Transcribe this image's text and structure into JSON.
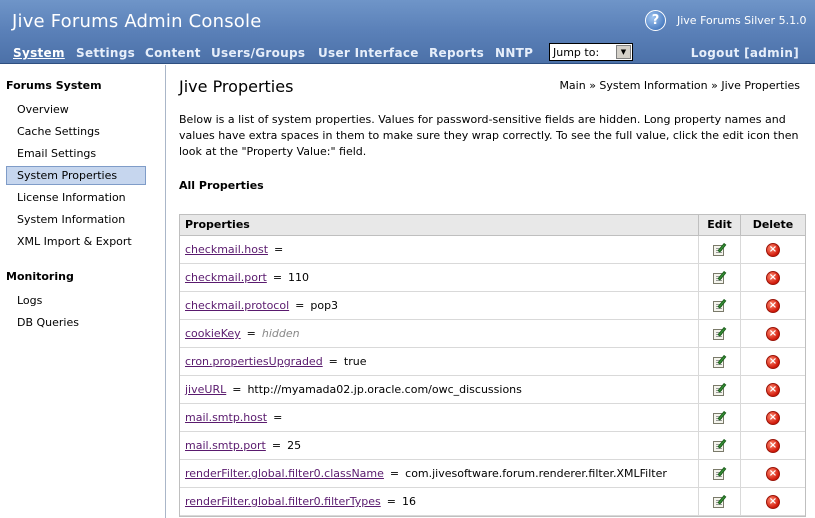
{
  "header": {
    "title": "Jive Forums Admin Console",
    "help_icon": "question-circle-icon",
    "edition": "Jive Forums Silver 5.1.0",
    "logout": "Logout [admin]",
    "jump_to": {
      "label": "Jump to:"
    }
  },
  "nav": [
    {
      "label": "System",
      "active": true
    },
    {
      "label": "Settings"
    },
    {
      "label": "Content"
    },
    {
      "label": "Users/Groups"
    },
    {
      "label": "User Interface"
    },
    {
      "label": "Reports"
    },
    {
      "label": "NNTP"
    }
  ],
  "sidebar": {
    "sections": [
      {
        "heading": "Forums System",
        "items": [
          "Overview",
          "Cache Settings",
          "Email Settings",
          "System Properties",
          "License Information",
          "System Information",
          "XML Import & Export"
        ]
      },
      {
        "heading": "Monitoring",
        "items": [
          "Logs",
          "DB Queries"
        ]
      }
    ],
    "active_item": "System Properties"
  },
  "main": {
    "title": "Jive Properties",
    "breadcrumb": "Main » System Information » Jive Properties",
    "description": "Below is a list of system properties. Values for password-sensitive fields are hidden. Long property names and values have extra spaces in them to make sure they wrap correctly. To see the full value, click the edit icon then look at the \"Property Value:\" field.",
    "section_title": "All Properties",
    "table": {
      "headers": {
        "properties": "Properties",
        "edit": "Edit",
        "delete": "Delete"
      },
      "edit_icon": "edit-document-icon",
      "delete_icon": "delete-circle-icon",
      "rows": [
        {
          "name": "checkmail.host",
          "value": ""
        },
        {
          "name": "checkmail.port",
          "value": "110"
        },
        {
          "name": "checkmail.protocol",
          "value": "pop3"
        },
        {
          "name": "cookieKey",
          "value": "hidden",
          "hidden": true
        },
        {
          "name": "cron.propertiesUpgraded",
          "value": "true"
        },
        {
          "name": "jiveURL",
          "value": "http://myamada02.jp.oracle.com/owc_discussions"
        },
        {
          "name": "mail.smtp.host",
          "value": ""
        },
        {
          "name": "mail.smtp.port",
          "value": "25"
        },
        {
          "name": "renderFilter.global.filter0.className",
          "value": "com.jivesoftware.forum.renderer.filter.XMLFilter"
        },
        {
          "name": "renderFilter.global.filter0.filterTypes",
          "value": "16"
        }
      ]
    }
  }
}
